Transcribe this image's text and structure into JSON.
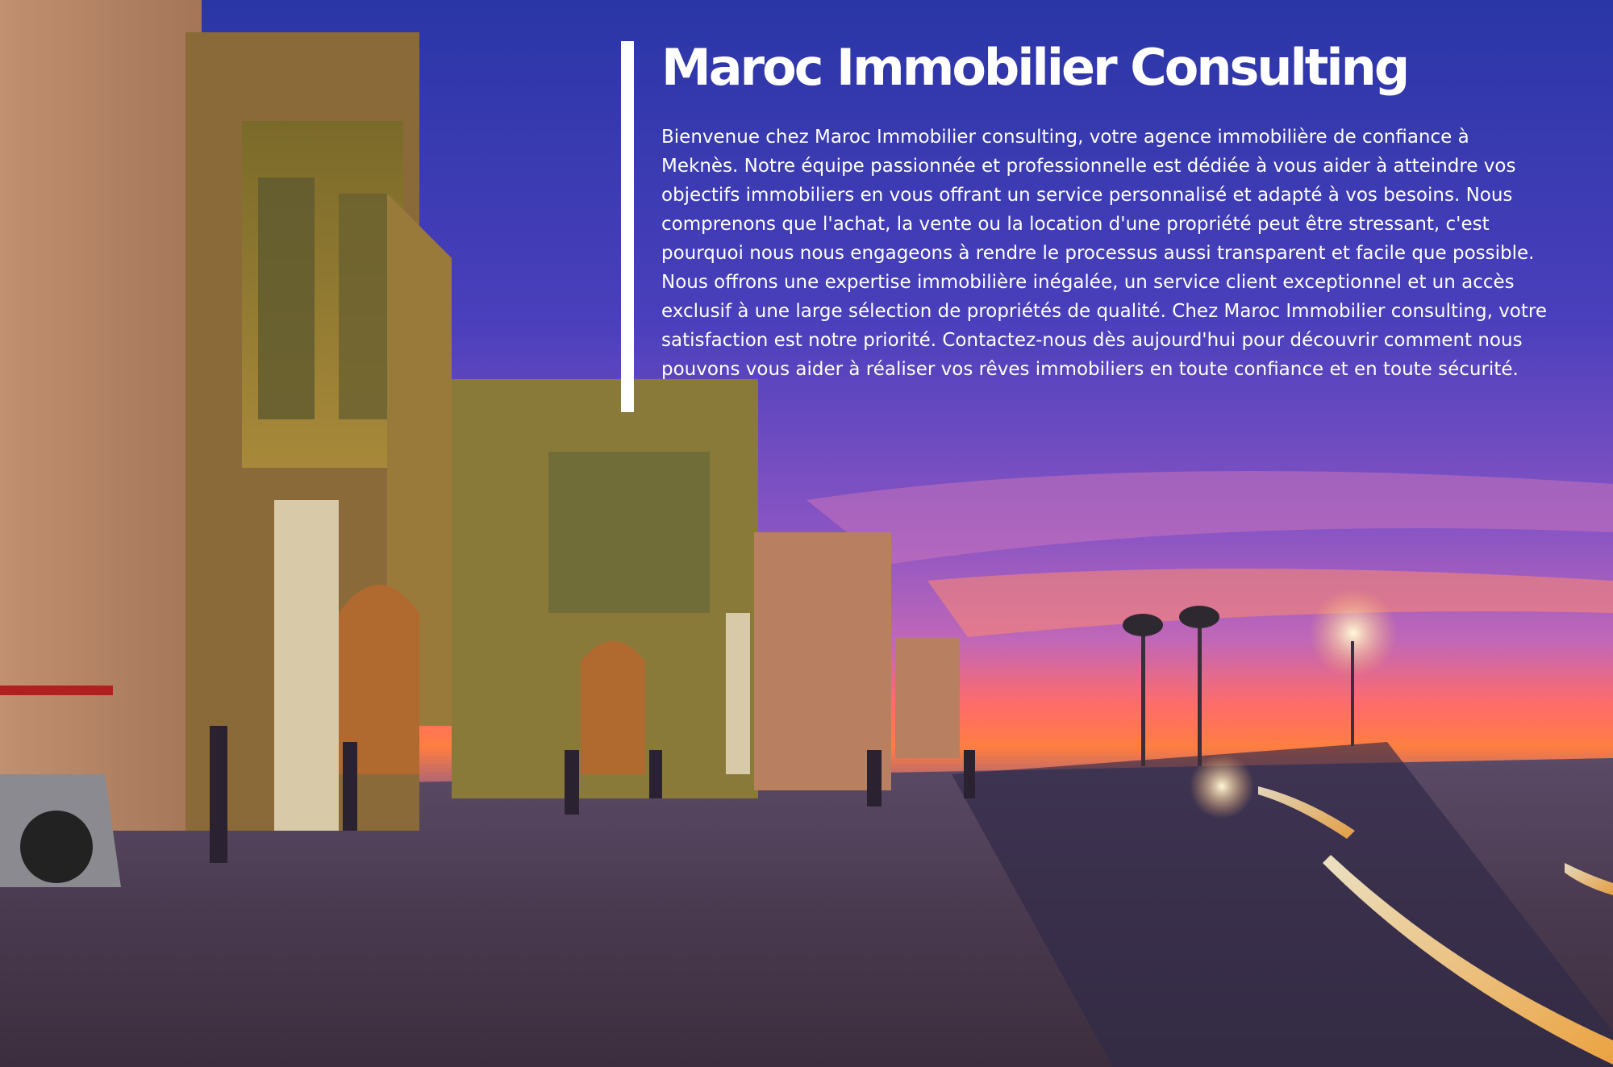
{
  "hero": {
    "title": "Maroc Immobilier Consulting",
    "body": "Bienvenue chez Maroc Immobilier consulting, votre agence immobilière de confiance à Meknès. Notre équipe passionnée et professionnelle est dédiée à vous aider à atteindre vos objectifs immobiliers en vous offrant un service personnalisé et adapté à vos besoins. Nous comprenons que l'achat, la vente ou la location d'une propriété peut être stressant, c'est pourquoi nous nous engageons à rendre le processus aussi transparent et facile que possible. Nous offrons une expertise immobilière inégalée, un service client exceptionnel et un accès exclusif à une large sélection de propriétés de qualité. Chez Maroc Immobilier consulting, votre satisfaction est notre priorité. Contactez-nous dès aujourd'hui pour découvrir comment nous pouvons vous aider à réaliser vos rêves immobiliers en toute confiance et en toute sécurité."
  },
  "colors": {
    "text": "#ffffff",
    "accent_bar": "#ffffff",
    "sky_top": "#2c3aa8",
    "sky_mid": "#7b4fc0",
    "sunset": "#ff5a3c",
    "wall": "#b88962",
    "pavement": "#4a3b4c"
  }
}
